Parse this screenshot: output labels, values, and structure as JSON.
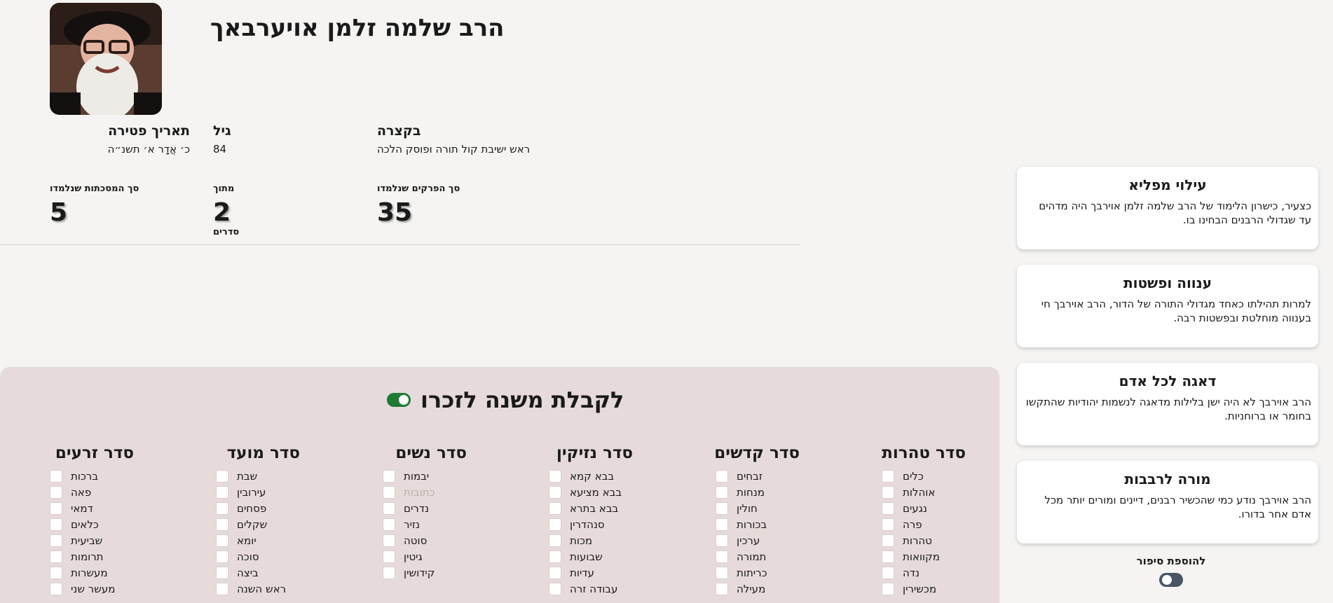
{
  "rabbi": {
    "name": "הרב שלמה זלמן אויערבאך"
  },
  "info": {
    "death_label": "תאריך פטירה",
    "death_value": "כ׳ אֲדָר א׳ תשנ״ה",
    "age_label": "גיל",
    "age_value": "84",
    "summary_label": "בקצרה",
    "summary_value": "ראש ישיבת קול תורה ופוסק הלכה"
  },
  "stats": {
    "tractates_label": "סך המסכתות שנלמדו",
    "tractates_value": "5",
    "of_label": "מתוך",
    "of_value": "2",
    "of_unit": "סדרים",
    "chapters_label": "סך הפרקים שנלמדו",
    "chapters_value": "35"
  },
  "panel": {
    "title": "לקבלת משנה לזכרו",
    "toggle_on": true,
    "sedarim": [
      {
        "title": "סדר זרעים",
        "tractates": [
          "ברכות",
          "פאה",
          "דמאי",
          "כלאים",
          "שביעית",
          "תרומות",
          "מעשרות",
          "מעשר שני"
        ]
      },
      {
        "title": "סדר מועד",
        "tractates": [
          "שבת",
          "עירובין",
          "פסחים",
          "שקלים",
          "יומא",
          "סוכה",
          "ביצה",
          "ראש השנה"
        ]
      },
      {
        "title": "סדר נשים",
        "tractates": [
          "יבמות",
          "כתובות",
          "נדרים",
          "נזיר",
          "סוטה",
          "גיטין",
          "קידושין"
        ]
      },
      {
        "title": "סדר נזיקין",
        "tractates": [
          "בבא קמא",
          "בבא מציעא",
          "בבא בתרא",
          "סנהדרין",
          "מכות",
          "שבועות",
          "עדיות",
          "עבודה זרה"
        ]
      },
      {
        "title": "סדר קדשים",
        "tractates": [
          "זבחים",
          "מנחות",
          "חולין",
          "בכורות",
          "ערכין",
          "תמורה",
          "כריתות",
          "מעילה"
        ]
      },
      {
        "title": "סדר טהרות",
        "tractates": [
          "כלים",
          "אוהלות",
          "נגעים",
          "פרה",
          "טהרות",
          "מקוואות",
          "נדה",
          "מכשירין"
        ]
      }
    ]
  },
  "cards": [
    {
      "title": "עילוי מפליא",
      "text": "כצעיר, כישרון הלימוד של הרב שלמה זלמן אוירבך היה מדהים עד שגדולי הרבנים הבחינו בו."
    },
    {
      "title": "ענווה ופשטות",
      "text": "למרות תהילתו כאחד מגדולי התורה של הדור, הרב אוירבך חי בענווה מוחלטת ובפשטות רבה."
    },
    {
      "title": "דאגה לכל אדם",
      "text": "הרב אוירבך לא היה ישן בלילות מדאגה לנשמות יהודיות שהתקשו בחומר או ברוחניות."
    },
    {
      "title": "מורה לרבבות",
      "text": "הרב אוירבך נודע כמי שהכשיר רבנים, דיינים ומורים יותר מכל אדם אחר בדורו."
    }
  ],
  "add_story": {
    "label": "להוספת סיפור",
    "toggle_on": false
  }
}
